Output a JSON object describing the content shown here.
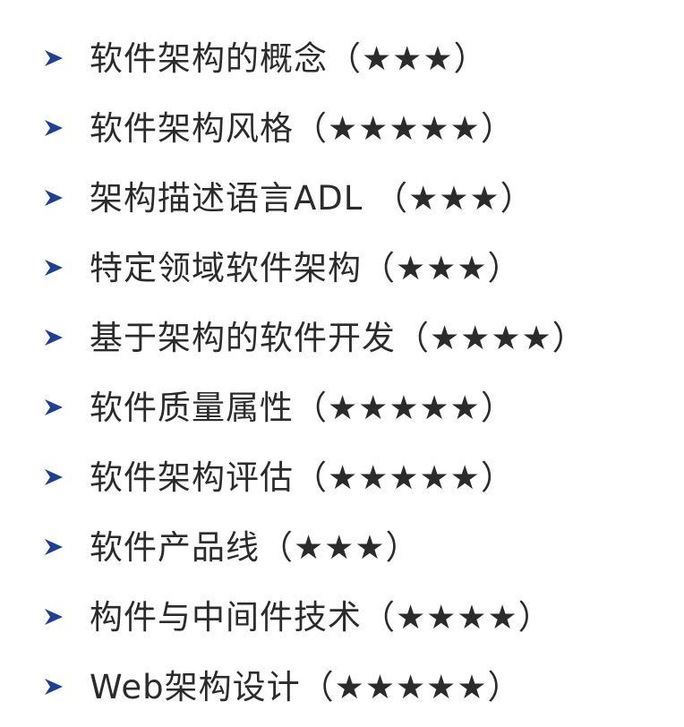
{
  "topics": [
    {
      "text": "软件架构的概念（★★★）"
    },
    {
      "text": "软件架构风格（★★★★★）"
    },
    {
      "text": "架构描述语言ADL （★★★）"
    },
    {
      "text": "特定领域软件架构（★★★）"
    },
    {
      "text": "基于架构的软件开发（★★★★）"
    },
    {
      "text": "软件质量属性（★★★★★）"
    },
    {
      "text": "软件架构评估（★★★★★）"
    },
    {
      "text": "软件产品线（★★★）"
    },
    {
      "text": "构件与中间件技术（★★★★）"
    },
    {
      "text": "Web架构设计（★★★★★）"
    }
  ],
  "colors": {
    "bullet": "#1f3f8f",
    "text": "#2b2b2b",
    "background": "#ffffff"
  },
  "icons": {
    "bullet": "arrowhead-bullet-icon"
  }
}
